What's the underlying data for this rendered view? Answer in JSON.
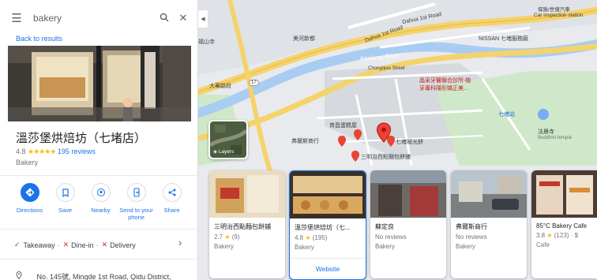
{
  "search": {
    "query": "bakery"
  },
  "back_link": "Back to results",
  "place": {
    "name": "溫莎堡烘焙坊（七堵店）",
    "rating": "4.8",
    "stars": "★★★★★",
    "reviews": "195 reviews",
    "category": "Bakery",
    "address": "No. 145號, Mingde 1st Road, Qidu District,"
  },
  "actions": [
    {
      "label": "Directions",
      "icon": "directions-icon"
    },
    {
      "label": "Save",
      "icon": "bookmark-icon"
    },
    {
      "label": "Nearby",
      "icon": "nearby-icon"
    },
    {
      "label": "Send to your phone",
      "icon": "phone-send-icon"
    },
    {
      "label": "Share",
      "icon": "share-icon"
    }
  ],
  "services": {
    "takeaway": "Takeaway",
    "dine_in": "Dine-in",
    "delivery": "Delivery",
    "sep": "·"
  },
  "map": {
    "layers_label": "Layers",
    "labels": {
      "dahua_1st_road": "Dahua 1st Road",
      "dahua_1st_road_b": "Dahua 1st Road",
      "meiho_newtown": "美河新都",
      "nissan": "NISSAN 七堵服務廠",
      "keelung_river": "Keelung River",
      "chongqiao_street": "Chongqiao Street",
      "temple_left": "福山寺",
      "dahua_road_zh": "大華路段",
      "route_17": "17",
      "qidu_station": "七堵站",
      "fazang_temple": "法晨寺",
      "buddhist_temple": "Buddhist temple",
      "bakery_xiao": "育昌蛋糕屋",
      "bakery_fu": "弗爾斯商行",
      "bakery_qi": "七堵賦光餅",
      "sanming": "三明治西點麵包餅鋪",
      "dental_1": "晶采牙醫聯合診所-植",
      "dental_2": "牙專科隱形矯正美...",
      "top_right_1": "保險/世億汽車",
      "top_right_2": "Car inspection station"
    }
  },
  "cards": [
    {
      "title": "三明治西點麵包餅鋪",
      "rating": "2.7",
      "reviews": "(9)",
      "category": "Bakery",
      "selected": false
    },
    {
      "title": "溫莎堡烘焙坊（七...",
      "rating": "4.8",
      "reviews": "(195)",
      "category": "Bakery",
      "selected": true,
      "website": "Website"
    },
    {
      "title": "蘇定良",
      "reviews_text": "No reviews",
      "category": "Bakery",
      "selected": false
    },
    {
      "title": "弗爾斯商行",
      "reviews_text": "No reviews",
      "category": "Bakery",
      "selected": false
    },
    {
      "title": "85°C Bakery Cafe",
      "rating": "3.8",
      "reviews": "(123)",
      "price": "· $",
      "category": "Cafe",
      "selected": false
    }
  ],
  "colors": {
    "accent": "#1a73e8",
    "star": "#fbbc04",
    "road_yellow": "#f5d36b",
    "river": "#a9cdf2",
    "poi_red": "#ea4335"
  }
}
